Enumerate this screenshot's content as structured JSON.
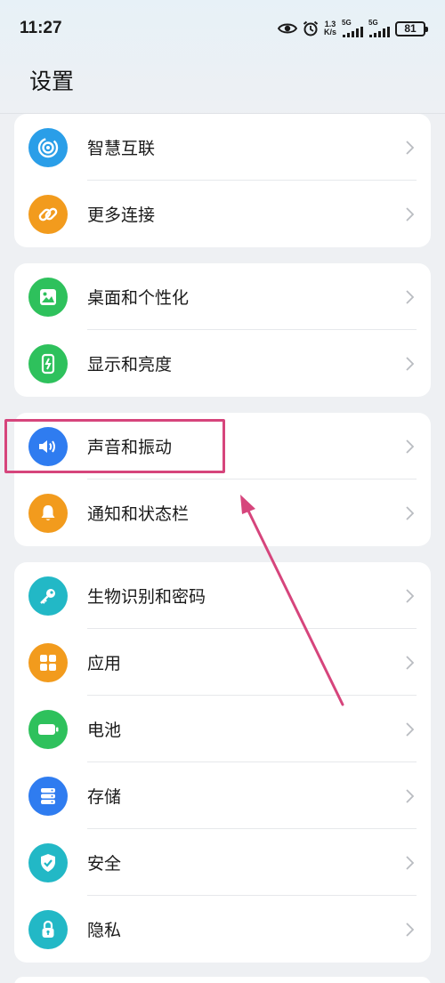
{
  "status_bar": {
    "time": "11:27",
    "net_speed_value": "1.3",
    "net_speed_unit": "K/s",
    "sim1_tag": "5G",
    "sim2_tag": "5G",
    "battery": "81"
  },
  "header": {
    "title": "设置"
  },
  "groups": [
    {
      "items": [
        {
          "label": "智慧互联",
          "icon": "smart-connect-icon",
          "color": "#2a9ee8"
        },
        {
          "label": "更多连接",
          "icon": "link-icon",
          "color": "#f29b1d"
        }
      ]
    },
    {
      "items": [
        {
          "label": "桌面和个性化",
          "icon": "image-icon",
          "color": "#2ec15c"
        },
        {
          "label": "显示和亮度",
          "icon": "phone-brightness-icon",
          "color": "#2ec15c"
        }
      ]
    },
    {
      "items": [
        {
          "label": "声音和振动",
          "icon": "speaker-icon",
          "color": "#2f7cf0"
        },
        {
          "label": "通知和状态栏",
          "icon": "bell-icon",
          "color": "#f29b1d"
        }
      ]
    },
    {
      "items": [
        {
          "label": "生物识别和密码",
          "icon": "key-icon",
          "color": "#22b8c6"
        },
        {
          "label": "应用",
          "icon": "apps-grid-icon",
          "color": "#f29b1d"
        },
        {
          "label": "电池",
          "icon": "battery-icon",
          "color": "#2ec15c"
        },
        {
          "label": "存储",
          "icon": "storage-icon",
          "color": "#2f7cf0"
        },
        {
          "label": "安全",
          "icon": "shield-check-icon",
          "color": "#22b8c6"
        },
        {
          "label": "隐私",
          "icon": "privacy-lock-icon",
          "color": "#22b8c6"
        }
      ]
    }
  ],
  "annotation": {
    "highlight_color": "#d6457c"
  }
}
